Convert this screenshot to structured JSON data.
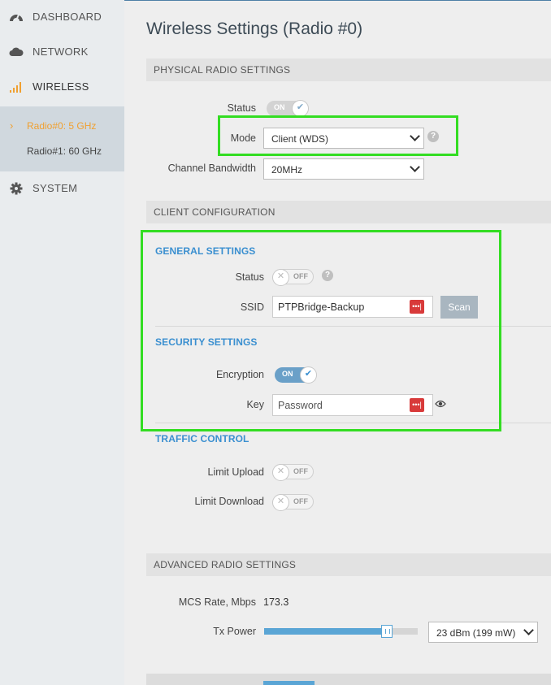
{
  "sidebar": {
    "items": [
      {
        "label": "DASHBOARD",
        "icon": "dashboard-gauge-icon"
      },
      {
        "label": "NETWORK",
        "icon": "cloud-icon"
      },
      {
        "label": "WIRELESS",
        "icon": "signal-bars-icon"
      },
      {
        "label": "SYSTEM",
        "icon": "gear-icon"
      }
    ],
    "sub_items": [
      {
        "label": "Radio#0: 5 GHz",
        "active": true
      },
      {
        "label": "Radio#1: 60 GHz",
        "active": false
      }
    ]
  },
  "page_title": "Wireless Settings (Radio #0)",
  "physical": {
    "heading": "PHYSICAL RADIO SETTINGS",
    "status_label": "Status",
    "status_toggle": "ON",
    "mode_label": "Mode",
    "mode_value": "Client (WDS)",
    "bandwidth_label": "Channel Bandwidth",
    "bandwidth_value": "20MHz"
  },
  "client": {
    "heading": "CLIENT CONFIGURATION",
    "general_heading": "GENERAL SETTINGS",
    "status_label": "Status",
    "status_toggle": "OFF",
    "ssid_label": "SSID",
    "ssid_value": "PTPBridge-Backup",
    "scan_label": "Scan",
    "security_heading": "SECURITY SETTINGS",
    "encryption_label": "Encryption",
    "encryption_toggle": "ON",
    "key_label": "Key",
    "key_placeholder": "Password",
    "traffic_heading": "TRAFFIC CONTROL",
    "limit_upload_label": "Limit Upload",
    "limit_upload_toggle": "OFF",
    "limit_download_label": "Limit Download",
    "limit_download_toggle": "OFF"
  },
  "advanced": {
    "heading": "ADVANCED RADIO SETTINGS",
    "mcs_label": "MCS Rate, Mbps",
    "mcs_value": "173.3",
    "tx_label": "Tx Power",
    "tx_level": 0.8,
    "tx_value": "23 dBm (199 mW)"
  },
  "colors": {
    "accent": "#3a8fd0",
    "active_nav": "#f0a030",
    "highlight": "#33dd22",
    "password_badge": "#d83a3a"
  },
  "pw_badge_glyph": "•••|",
  "help_glyph": "?",
  "chevron_glyph": "›"
}
